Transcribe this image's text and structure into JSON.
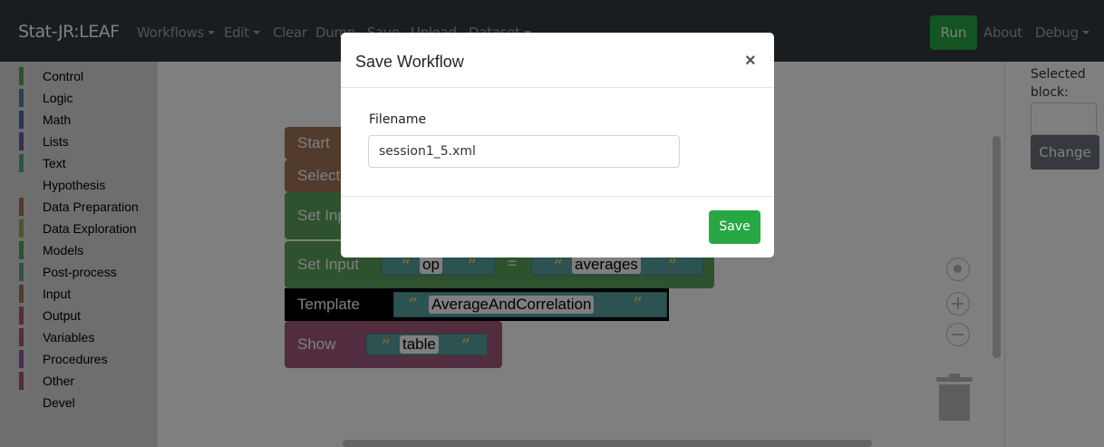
{
  "navbar": {
    "brand": "Stat-JR:LEAF",
    "items": [
      "Workflows",
      "Edit",
      "Clear",
      "Dump",
      "Save",
      "Upload",
      "Dataset"
    ],
    "run_label": "Run",
    "about_label": "About",
    "debug_label": "Debug"
  },
  "toolbox": {
    "items": [
      {
        "label": "Control",
        "color": "#5ba55b"
      },
      {
        "label": "Logic",
        "color": "#5b80a5"
      },
      {
        "label": "Math",
        "color": "#5b67a5"
      },
      {
        "label": "Lists",
        "color": "#745ba5"
      },
      {
        "label": "Text",
        "color": "#5ba58c"
      },
      {
        "label": "Hypothesis",
        "color": ""
      },
      {
        "label": "Data Preparation",
        "color": "#a5745b"
      },
      {
        "label": "Data Exploration",
        "color": "#a5a55b"
      },
      {
        "label": "Models",
        "color": "#5ba55b"
      },
      {
        "label": "Post-process",
        "color": "#5ba58c"
      },
      {
        "label": "Input",
        "color": "#a5745b"
      },
      {
        "label": "Output",
        "color": "#a55b80"
      },
      {
        "label": "Variables",
        "color": "#a55b80"
      },
      {
        "label": "Procedures",
        "color": "#995ba5"
      },
      {
        "label": "Other",
        "color": "#a55b80"
      },
      {
        "label": "Devel",
        "color": ""
      }
    ]
  },
  "workspace": {
    "blocks": {
      "start": "Start",
      "select": "Select",
      "set_input_1": "Set Input",
      "set_input_2": "Set Input",
      "set_input_2_key": "op",
      "set_input_2_eq": "=",
      "set_input_2_value": "averages",
      "template": "Template",
      "template_value": "AverageAndCorrelation",
      "show": "Show",
      "show_value": "table"
    }
  },
  "right_panel": {
    "selected_label": "Selected block:",
    "change_label": "Change"
  },
  "modal": {
    "title": "Save Workflow",
    "close": "×",
    "filename_label": "Filename",
    "filename_value": "session1_5.xml",
    "save_label": "Save"
  }
}
